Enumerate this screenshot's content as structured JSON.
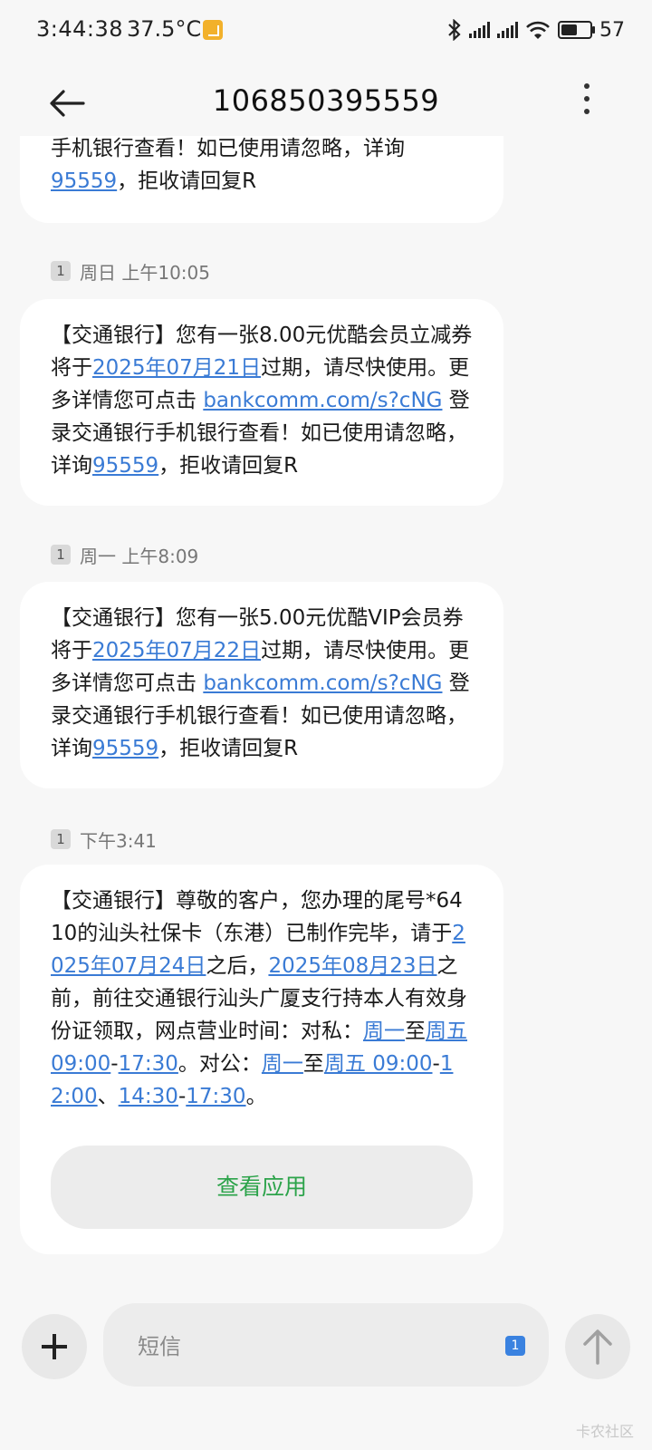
{
  "status_bar": {
    "time": "3:44:38",
    "temperature": "37.5°C",
    "battery": "57",
    "battery_level": 0.57,
    "icons": [
      "bluetooth-icon",
      "signal-icon",
      "signal-icon",
      "wifi-icon",
      "battery-icon"
    ]
  },
  "header": {
    "title": "106850395559",
    "back_icon": "back-arrow-icon",
    "menu_icon": "more-vert-icon"
  },
  "messages": [
    {
      "partial": true,
      "line1": "手机银行查看！如已使用请忽略，详询",
      "phone": "95559",
      "tail": "，拒收请回复R"
    },
    {
      "sim": "1",
      "timestamp": "周日 上午10:05",
      "p1": "【交通银行】您有一张8.00元优酷会员立减券将于",
      "date": "2025年07月21日",
      "p2": "过期，请尽快使用。更多详情您可点击 ",
      "url": "bankcomm.com/s?cNG",
      "p3": " 登录交通银行手机银行查看！如已使用请忽略，详询",
      "phone": "95559",
      "p4": "，拒收请回复R"
    },
    {
      "sim": "1",
      "timestamp": "周一 上午8:09",
      "p1": "【交通银行】您有一张5.00元优酷VIP会员券将于",
      "date": "2025年07月22日",
      "p2": "过期，请尽快使用。更多详情您可点击 ",
      "url": "bankcomm.com/s?cNG",
      "p3": " 登录交通银行手机银行查看！如已使用请忽略，详询",
      "phone": "95559",
      "p4": "，拒收请回复R"
    },
    {
      "sim": "1",
      "timestamp": "下午3:41",
      "t1": "【交通银行】尊敬的客户，您办理的尾号*6410的汕头社保卡（东港）已制作完毕，请于",
      "d1": "2025年07月24日",
      "t2": "之后，",
      "d2": "2025年08月23日",
      "t3": "之前，前往交通银行汕头广厦支行持本人有效身份证领取，网点营业时间：对私：",
      "l1": "周一",
      "t4": "至",
      "l2": "周五 09:00",
      "t5": "-",
      "l3": "17:30",
      "t6": "。对公：",
      "l4": "周一",
      "t7": "至",
      "l5": "周五 09:00",
      "t8": "-",
      "l6": "12:00",
      "t9": "、",
      "l7": "14:30",
      "t10": "-",
      "l8": "17:30",
      "t11": "。",
      "button": "查看应用"
    }
  ],
  "composer": {
    "placeholder": "短信",
    "sim": "1",
    "plus_icon": "plus-icon",
    "send_icon": "send-arrow-icon"
  },
  "watermark": "卡农社区"
}
